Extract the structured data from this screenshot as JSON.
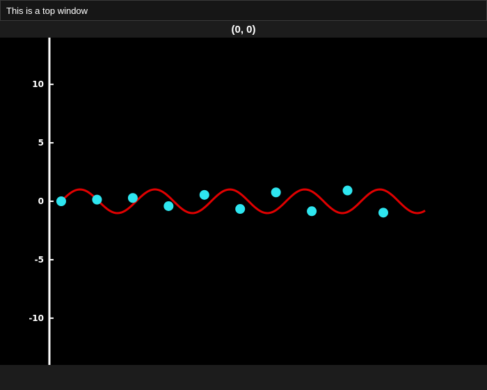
{
  "window": {
    "title": "This is a top window"
  },
  "readout": {
    "coordinate_text": "(0, 0)"
  },
  "colors": {
    "background": "#000000",
    "axis": "#ffffff",
    "curve": "#e00000",
    "points": "#2ee6f0"
  },
  "chart_data": {
    "type": "line",
    "title": "",
    "xlabel": "",
    "ylabel": "",
    "ylim": [
      -14,
      14
    ],
    "xlim": [
      -1,
      30.5
    ],
    "grid": false,
    "yticks": [
      {
        "value": 10,
        "label": "10"
      },
      {
        "value": 5,
        "label": "5"
      },
      {
        "value": 0,
        "label": "0"
      },
      {
        "value": -5,
        "label": "-5"
      },
      {
        "value": -10,
        "label": "-10"
      }
    ],
    "series": [
      {
        "kind": "curve",
        "function": "sin",
        "x_range": [
          0,
          30.5
        ],
        "samples": 200
      },
      {
        "kind": "points",
        "x": [
          0,
          3,
          6,
          9,
          12,
          15,
          18,
          21,
          24,
          27
        ],
        "y": [
          0,
          0.14,
          0.28,
          -0.41,
          0.54,
          -0.65,
          0.75,
          -0.84,
          0.91,
          -0.96
        ]
      }
    ]
  }
}
